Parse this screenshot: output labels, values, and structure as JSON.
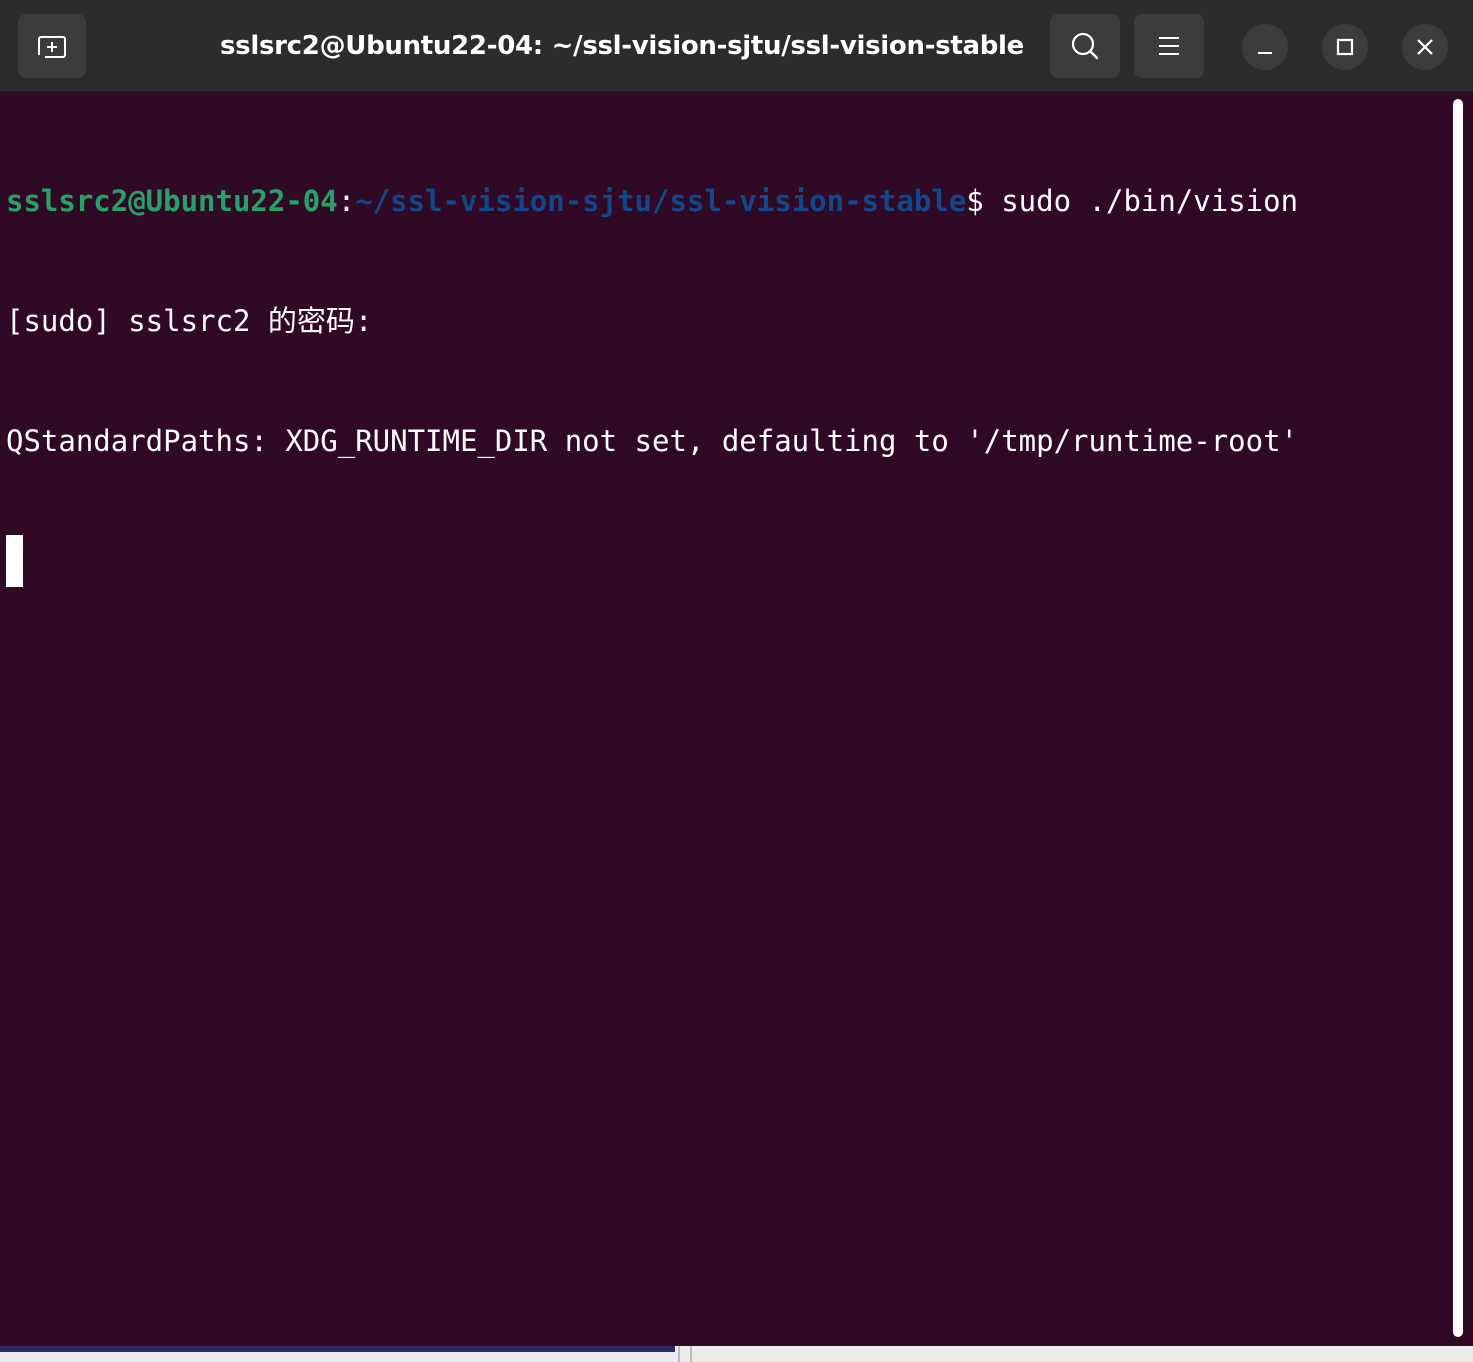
{
  "window": {
    "title": "sslsrc2@Ubuntu22-04: ~/ssl-vision-sjtu/ssl-vision-stable"
  },
  "headerbar": {
    "new_tab_icon": "new-tab-icon",
    "search_icon": "search-icon",
    "menu_icon": "hamburger-menu-icon",
    "minimize_icon": "minimize-icon",
    "maximize_icon": "maximize-icon",
    "close_icon": "close-icon"
  },
  "terminal": {
    "prompt_user_host": "sslsrc2@Ubuntu22-04",
    "prompt_colon": ":",
    "prompt_path": "~/ssl-vision-sjtu/ssl-vision-stable",
    "prompt_symbol": "$",
    "command": " sudo ./bin/vision",
    "line2": "[sudo] sslsrc2 的密码:",
    "line3": "QStandardPaths: XDG_RUNTIME_DIR not set, defaulting to '/tmp/runtime-root'"
  },
  "colors": {
    "background": "#300a24",
    "header": "#2c2c2c",
    "prompt_user": "#26a269",
    "prompt_path": "#12488b",
    "text": "#ffffff"
  }
}
